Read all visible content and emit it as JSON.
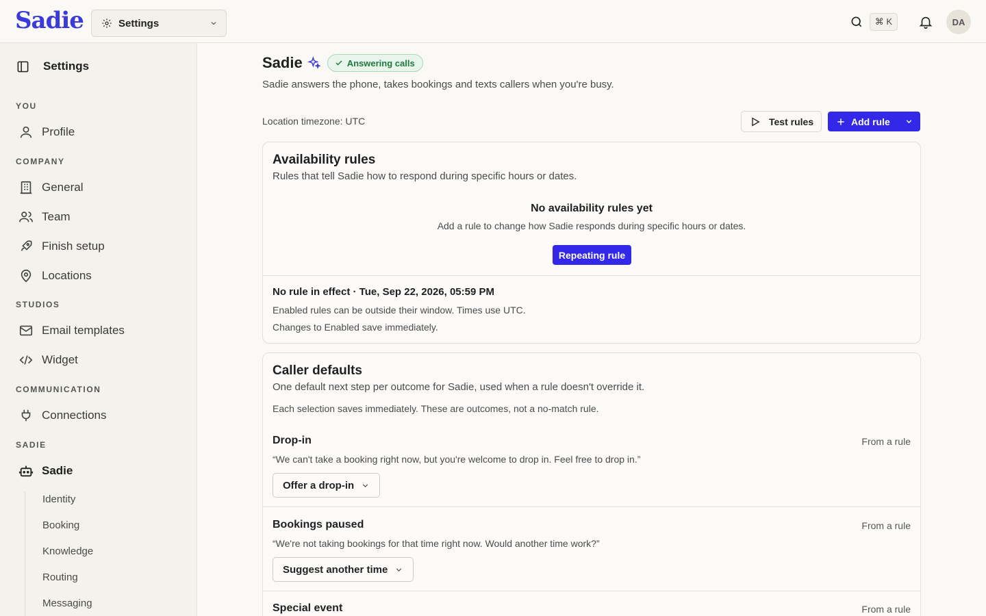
{
  "brand": {
    "logo": "Sadie",
    "accent": "#3327e8"
  },
  "topbar": {
    "workspace_select": "Settings",
    "search_icon": "search-icon",
    "shortcut": "⌘ K",
    "avatar_initials": "DA"
  },
  "sidebar": {
    "header": "Settings",
    "sections": {
      "you": "YOU",
      "company": "COMPANY",
      "studios": "STUDIOS",
      "communication": "COMMUNICATION",
      "sadie": "SADIE"
    },
    "items": {
      "profile": "Profile",
      "general": "General",
      "team": "Team",
      "finish_setup": "Finish setup",
      "locations": "Locations",
      "email_templates": "Email templates",
      "widget": "Widget",
      "connections": "Connections",
      "sadie": "Sadie"
    },
    "sub_items": [
      "Identity",
      "Booking",
      "Knowledge",
      "Routing",
      "Messaging"
    ]
  },
  "main": {
    "title": "Sadie",
    "status_badge": "Answering calls",
    "subtitle": "Sadie answers the phone, takes bookings and texts callers when you're busy.",
    "timezone": "Location timezone: UTC",
    "test_button": "Test rules",
    "add_button": "Add rule",
    "availability": {
      "title": "Availability rules",
      "description": "Rules that tell Sadie how to respond during specific hours or dates.",
      "empty_title": "No availability rules yet",
      "empty_description": "Add a rule to change how Sadie responds during specific hours or dates.",
      "empty_button": "Repeating rule",
      "status_title": "No rule in effect · Tue, Sep 22, 2026, 05:59 PM",
      "status_line1": "Enabled rules can be outside their window. Times use UTC.",
      "status_line2": "Changes to Enabled save immediately."
    },
    "caller_defaults": {
      "title": "Caller defaults",
      "description": "One default next step per outcome for Sadie, used when a rule doesn't override it.",
      "note": "Each selection saves immediately. These are outcomes, not a no-match rule.",
      "outcomes": [
        {
          "title": "Drop-in",
          "source": "From a rule",
          "quote": "“We can't take a booking right now, but you're welcome to drop in. Feel free to drop in.”",
          "selected": "Offer a drop-in"
        },
        {
          "title": "Bookings paused",
          "source": "From a rule",
          "quote": "“We're not taking bookings for that time right now. Would another time work?”",
          "selected": "Suggest another time"
        },
        {
          "title": "Special event",
          "source": "From a rule"
        }
      ]
    }
  }
}
